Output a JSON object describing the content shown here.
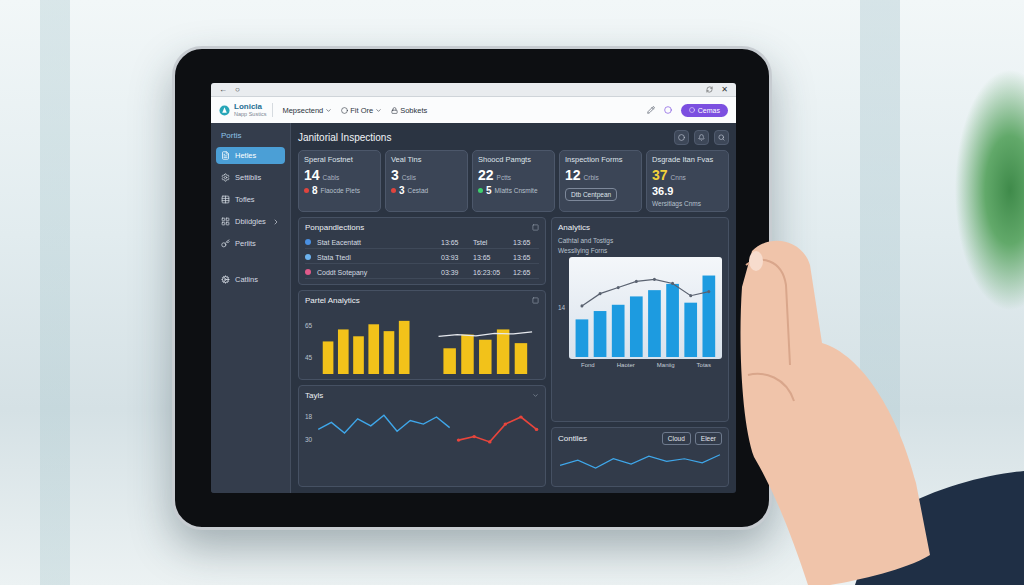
{
  "browser": {
    "back": "←",
    "reload": "○",
    "close": "✕"
  },
  "app_header": {
    "logo_name": "Lonicla",
    "logo_sub": "Napp Sustics",
    "menus": [
      {
        "label": "Mepsectend",
        "dropdown": true
      },
      {
        "label": "Fit Ore",
        "dropdown": true
      },
      {
        "label": "Sobkets",
        "dropdown": false
      }
    ],
    "button": "Cemas"
  },
  "sidebar": {
    "title": "Portis",
    "items": [
      {
        "label": "Hetles",
        "selected": true,
        "expandable": false
      },
      {
        "label": "Settiblis",
        "selected": false,
        "expandable": false
      },
      {
        "label": "Tofles",
        "selected": false,
        "expandable": false
      },
      {
        "label": "Dbiidgles",
        "selected": false,
        "expandable": true
      },
      {
        "label": "Perlits",
        "selected": false,
        "expandable": false
      }
    ],
    "footer_item": "Catlins"
  },
  "page": {
    "title": "Janitorial Inspections"
  },
  "stats": [
    {
      "kind": "dot",
      "title": "Speral Fostnet",
      "value": "14",
      "unit": "Cabls",
      "sub_value": "8",
      "sub_label": "Flaocde Piets",
      "color": "#e0443e"
    },
    {
      "kind": "dot",
      "title": "Veal Tins",
      "value": "3",
      "unit": "Cslis",
      "sub_value": "3",
      "sub_label": "Cestad",
      "color": "#e0443e"
    },
    {
      "kind": "dot",
      "title": "Shoocd Pamgts",
      "value": "22",
      "unit": "Pctts",
      "sub_value": "5",
      "sub_label": "Mlatts Cnsmite",
      "color": "#3ecf6e"
    },
    {
      "kind": "button",
      "title": "Inspection Forms",
      "value": "12",
      "unit": "Crbis",
      "button": "Dtb Centpean"
    },
    {
      "kind": "highlight",
      "title": "Dsgrade Itan Fvas",
      "value": "37",
      "unit": "Cnns",
      "sub_value": "36.9",
      "sub_label": "Wersitlags Cnms",
      "color": "#f2d13a"
    }
  ],
  "inspections_table": {
    "title": "Ponpandlections",
    "rows": [
      {
        "name": "Stat Eacentatt",
        "cells": [
          "13:65",
          "Tstel",
          "13:65"
        ],
        "color": "#4a90e2"
      },
      {
        "name": "Stata Ttedl",
        "cells": [
          "03:93",
          "13:65",
          "13:65"
        ],
        "color": "#6cb2ee"
      },
      {
        "name": "Coddt Sotepany",
        "cells": [
          "03:39",
          "16:23:05",
          "12:65"
        ],
        "color": "#e05a8a"
      }
    ]
  },
  "partial_analytics": {
    "title": "Partel Analytics",
    "ticks": [
      "65",
      "45"
    ],
    "bars_a": [
      38,
      52,
      44,
      58,
      50,
      62
    ],
    "bars_b": [
      30,
      46,
      40,
      52,
      36
    ],
    "line": [
      48,
      55,
      50,
      60,
      58,
      66
    ]
  },
  "analytics": {
    "title": "Analytics",
    "subtitle": "Cathtal and Tostigs",
    "chart_title": "Wessliying Forns",
    "tick": "14",
    "x_labels": [
      "Fond",
      "Haoter",
      "Maniig",
      "Totas"
    ],
    "bars": [
      36,
      44,
      50,
      58,
      64,
      70,
      52,
      78
    ],
    "line": [
      48,
      60,
      66,
      72,
      74,
      70,
      58,
      62
    ]
  },
  "trends": {
    "title": "Tayls",
    "ticks": [
      "18",
      "30"
    ],
    "blue": [
      22,
      30,
      18,
      34,
      26,
      38,
      20,
      32,
      28,
      36,
      24
    ],
    "red": [
      10,
      14,
      8,
      28,
      36,
      22
    ]
  },
  "controls": {
    "title": "Contlles",
    "buttons": [
      "Cloud",
      "Eleer"
    ],
    "line": [
      20,
      28,
      16,
      30,
      22,
      34,
      26,
      30,
      24,
      36
    ]
  }
}
